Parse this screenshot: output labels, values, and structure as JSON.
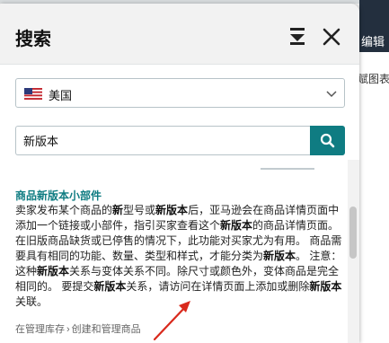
{
  "background": {
    "edit_label": "编辑",
    "link_text": "赋图表"
  },
  "panel": {
    "title": "搜索",
    "pin_icon": "pin-bottom-icon",
    "close_icon": "close-icon"
  },
  "marketplace": {
    "selected": "美国",
    "flag": "us-flag-icon"
  },
  "search": {
    "value": "新版本",
    "button_icon": "search-icon",
    "accent": "#0f7c82"
  },
  "result": {
    "title": "商品新版本小部件",
    "body": [
      {
        "t": "卖家发布某个商品的",
        "b": false
      },
      {
        "t": "新",
        "b": true
      },
      {
        "t": "型号或",
        "b": false
      },
      {
        "t": "新版本",
        "b": true
      },
      {
        "t": "后，亚马逊会在商品详情页面中添加一个链接或小部件，指引买家查看这个",
        "b": false
      },
      {
        "t": "新版本",
        "b": true
      },
      {
        "t": "的商品详情页面。在旧版商品缺货或已停售的情况下，此功能对买家尤为有用。 商品需要具有相同的功能、数量、类型和样式，才能分类为",
        "b": false
      },
      {
        "t": "新版本",
        "b": true
      },
      {
        "t": "。 注意： 这种",
        "b": false
      },
      {
        "t": "新版本",
        "b": true
      },
      {
        "t": "关系与变体关系不同。除尺寸或颜色外，变体商品是完全相同的。 要提交",
        "b": false
      },
      {
        "t": "新版本",
        "b": true
      },
      {
        "t": "关系，请访问在详情页面上添加或删除",
        "b": false
      },
      {
        "t": "新版本",
        "b": true
      },
      {
        "t": "关联。",
        "b": false
      }
    ],
    "path": [
      "在管理库存",
      "创建和管理商品"
    ],
    "path_separator": "›"
  }
}
